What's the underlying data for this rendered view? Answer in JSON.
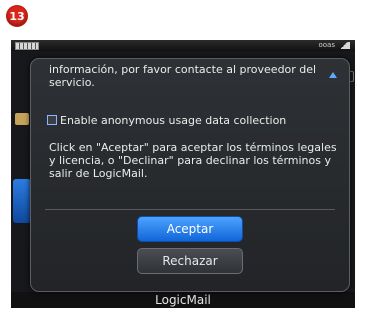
{
  "step_badge": "13",
  "status_bar": {
    "carrier": "ooas"
  },
  "background_app": {
    "title": "LogicMail"
  },
  "dialog": {
    "intro_text": "información, por favor contacte al proveedor del servicio.",
    "checkbox_label": "Enable anonymous usage data collection",
    "checkbox_checked": false,
    "body_text": "Click en \"Aceptar\" para aceptar los términos legales y licencia, o \"Declinar\" para declinar los términos y salir de LogicMail.",
    "accept_label": "Aceptar",
    "reject_label": "Rechazar"
  },
  "colors": {
    "accent": "#2a86f0",
    "badge": "#d9261c",
    "dialog_bg": "#2a2d31"
  }
}
